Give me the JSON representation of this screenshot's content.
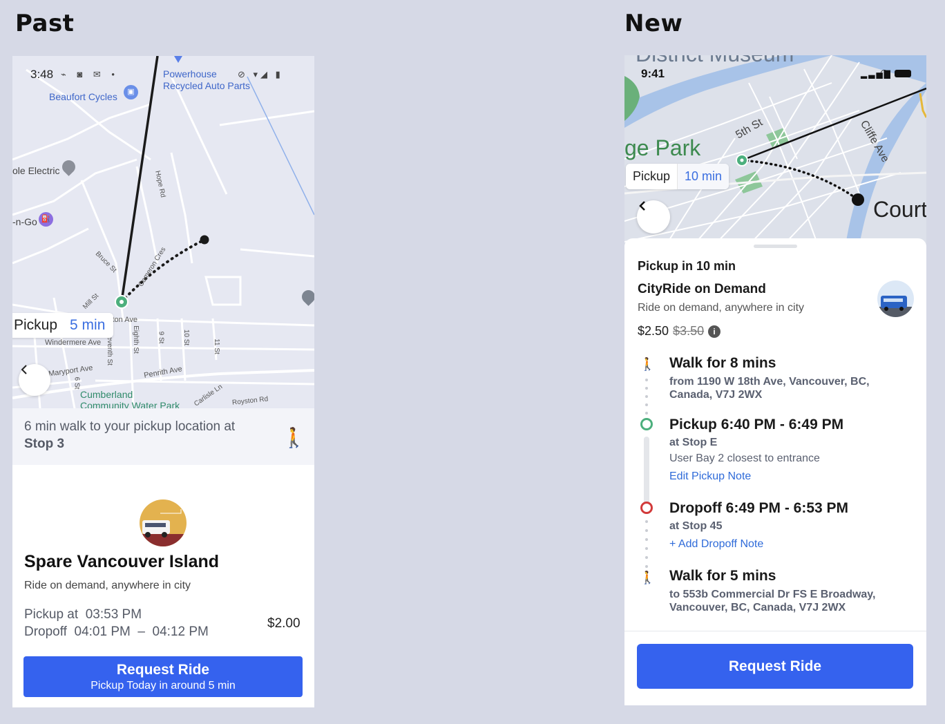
{
  "headings": {
    "past": "Past",
    "new": "New"
  },
  "past": {
    "status": {
      "time": "3:48"
    },
    "map_labels": {
      "powerhouse": "Powerhouse",
      "recycled": "Recycled Auto Parts",
      "beaufort": "Beaufort Cycles",
      "electric": "ole Electric",
      "ngo": "-n-Go",
      "bruce": "Bruce St",
      "cameron": "Cameron Cres",
      "hope": "Hope Rd",
      "mill": "Mill St",
      "windermere": "Windermere Ave",
      "eighth": "Eighth St",
      "seventh": "Seventh St",
      "st9": "9 St",
      "st10": "10 St",
      "st11": "11 St",
      "maryport": "Maryport Ave",
      "st6": "6 St",
      "penrith": "Penrith Ave",
      "cumberland1": "Cumberland",
      "cumberland2": "Community Water Park",
      "carlisle": "Carlisle Ln",
      "royston": "Royston Rd",
      "ston": "ston Ave"
    },
    "pickup_pill": {
      "label": "Pickup",
      "value": "5 min"
    },
    "walk_banner": {
      "text": "6 min walk to your pickup location at",
      "stop": "Stop 3"
    },
    "service": {
      "name": "Spare Vancouver Island",
      "desc": "Ride on demand, anywhere in city"
    },
    "times": {
      "pickup": "Pickup at  03:53 PM",
      "dropoff": "Dropoff  04:01 PM  –  04:12 PM"
    },
    "price": "$2.00",
    "button": {
      "title": "Request Ride",
      "subtitle": "Pickup Today in around 5 min"
    }
  },
  "new": {
    "status": {
      "time": "9:41"
    },
    "map_labels": {
      "park": "ge Park",
      "fifth": "5th St",
      "cliffe": "Cliffe Ave",
      "court": "Court",
      "museum": "District Museum"
    },
    "pickup_pill": {
      "label": "Pickup",
      "value": "10 min"
    },
    "sheet": {
      "pickup_in": "Pickup in 10 min",
      "service_name": "CityRide on Demand",
      "service_desc": "Ride on demand, anywhere in city",
      "price": "$2.50",
      "old_price": "$3.50"
    },
    "timeline": {
      "walk1_title": "Walk for 8 mins",
      "walk1_addr": "from 1190 W 18th Ave, Vancouver, BC, Canada, V7J 2WX",
      "pickup_title": "Pickup 6:40 PM - 6:49 PM",
      "pickup_stop": "at Stop E",
      "pickup_note": "User Bay 2 closest to entrance",
      "pickup_edit": "Edit Pickup Note",
      "dropoff_title": "Dropoff 6:49 PM - 6:53 PM",
      "dropoff_stop": "at Stop 45",
      "dropoff_add": "+ Add Dropoff Note",
      "walk2_title": "Walk for 5 mins",
      "walk2_addr": "to 553b Commercial Dr FS E Broadway, Vancouver, BC, Canada, V7J 2WX"
    },
    "button": {
      "title": "Request Ride"
    }
  },
  "colors": {
    "accent": "#3562ee",
    "pickup_green": "#4caf7d",
    "dropoff_red": "#d23a3a",
    "map_bg": "#e6e8f2",
    "new_map_bg": "#dde1ea",
    "water": "#a8c3e8",
    "link": "#2f6bd9"
  }
}
